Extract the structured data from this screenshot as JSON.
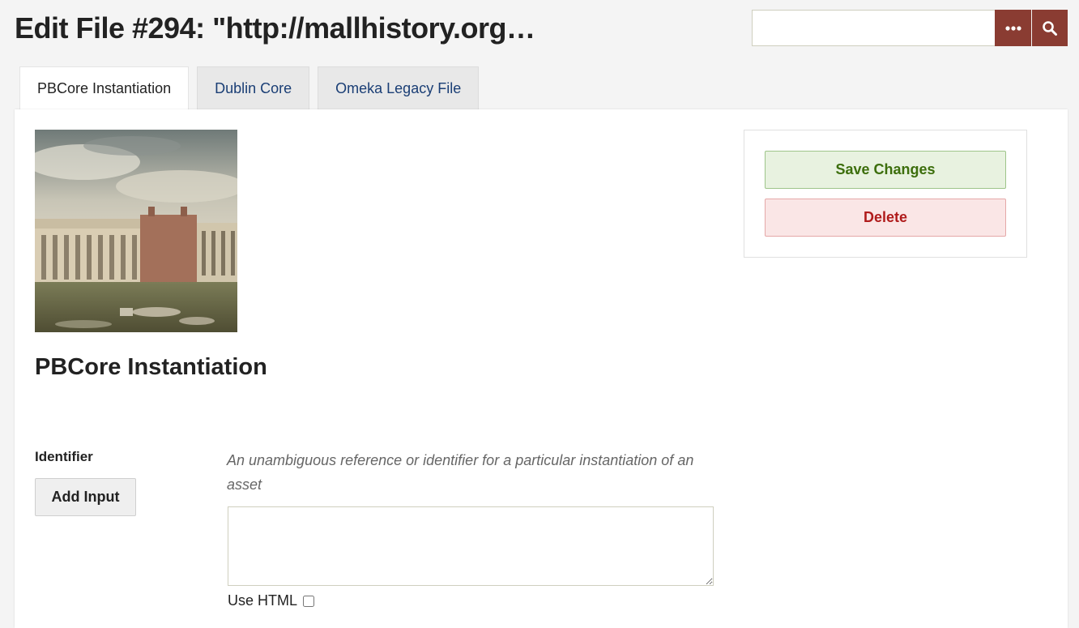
{
  "header": {
    "title": "Edit File #294: \"http://mallhistory.org…",
    "search_placeholder": "",
    "more_icon": "ellipsis-icon",
    "search_icon": "search-icon"
  },
  "tabs": [
    {
      "label": "PBCore Instantiation",
      "active": true
    },
    {
      "label": "Dublin Core",
      "active": false
    },
    {
      "label": "Omeka Legacy File",
      "active": false
    }
  ],
  "main": {
    "thumbnail_alt": "historic building illustration",
    "section_title": "PBCore Instantiation",
    "field": {
      "label": "Identifier",
      "add_input_label": "Add Input",
      "description": "An unambiguous reference or identifier for a particular instantiation of an asset",
      "value": "",
      "use_html_label": "Use HTML",
      "use_html_checked": false
    }
  },
  "actions": {
    "save_label": "Save Changes",
    "delete_label": "Delete"
  },
  "colors": {
    "brand": "#8a3c32",
    "save_bg": "#e8f2e0",
    "save_text": "#3c6e0c",
    "delete_bg": "#fae6e6",
    "delete_text": "#b01c1c",
    "link": "#1a3e75"
  }
}
